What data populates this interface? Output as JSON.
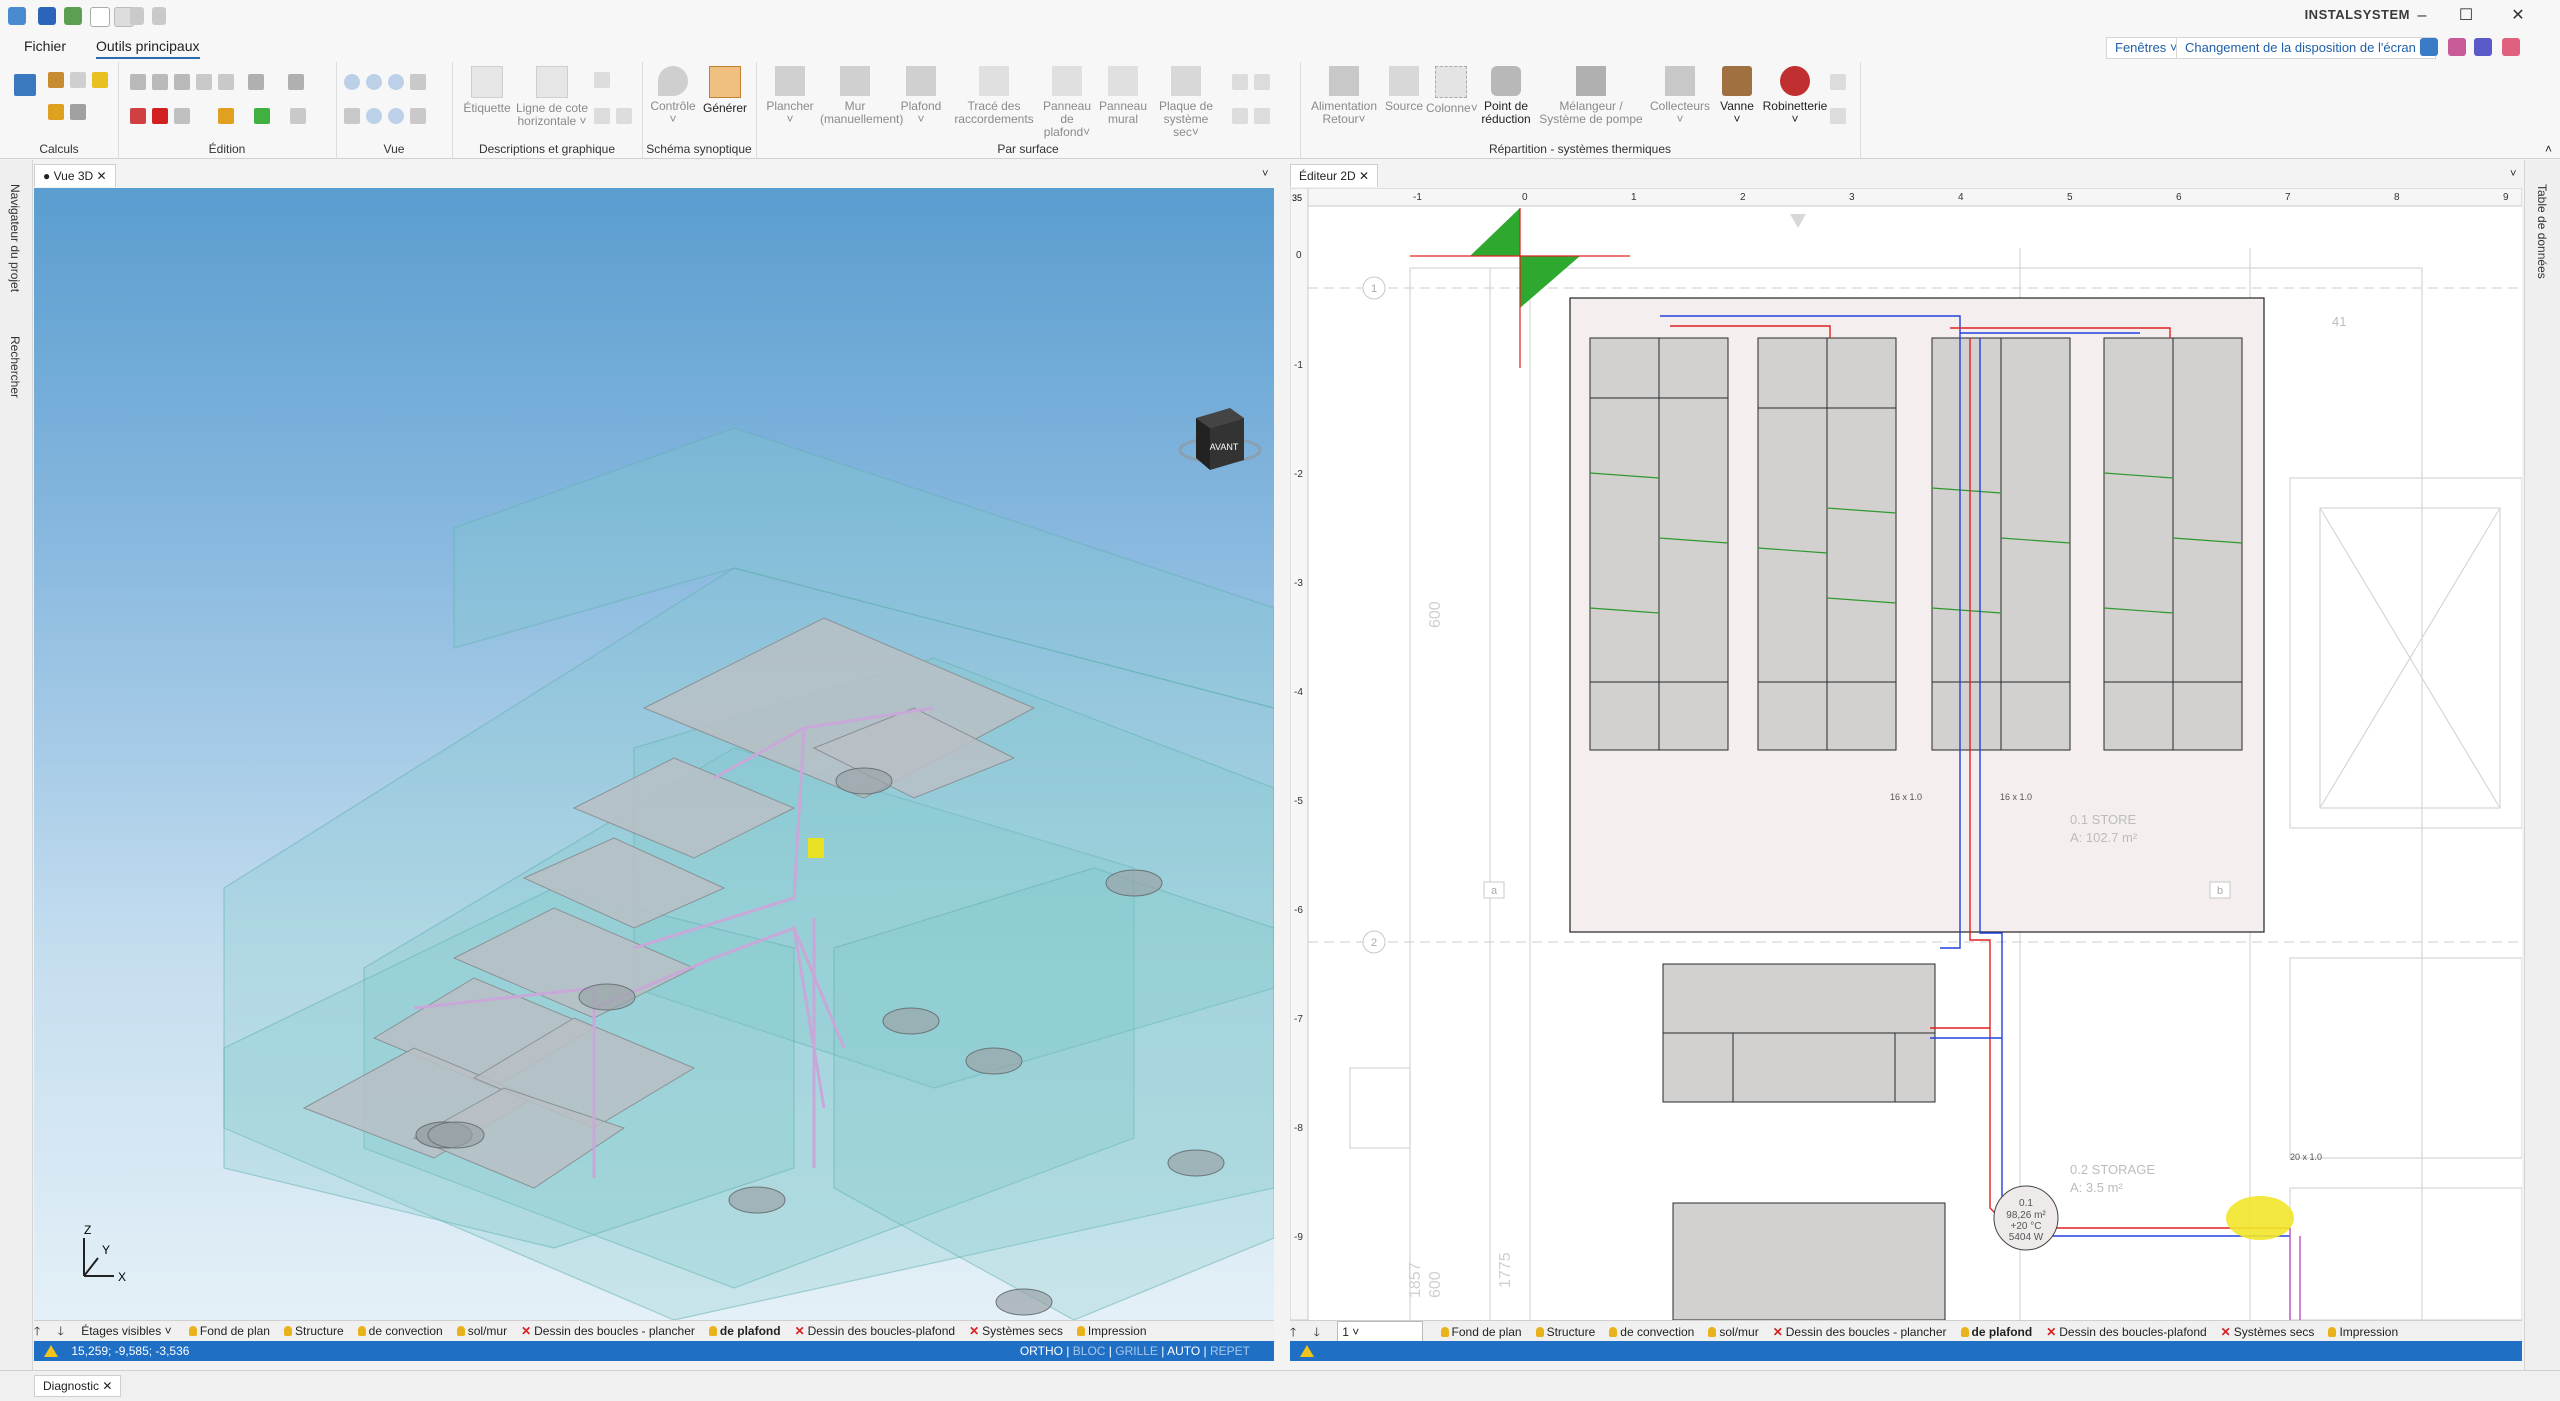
{
  "app": {
    "brand": "INSTALSYSTEM",
    "window_controls": [
      "minimize-icon",
      "maximize-icon",
      "close-icon"
    ]
  },
  "menu": {
    "tabs": [
      "Fichier",
      "Outils principaux"
    ],
    "right": {
      "windows": "Fenêtres",
      "layout": "Changement de la disposition de l'écran"
    }
  },
  "ribbon": {
    "groups": [
      "Calculs",
      "Édition",
      "Vue",
      "Descriptions et graphique",
      "Schéma synoptique",
      "Par surface",
      "Répartition - systèmes thermiques"
    ],
    "buttons": {
      "etiquette": "Étiquette",
      "ligne_cote": "Ligne de cote horizontale",
      "controle": "Contrôle",
      "generer": "Générer",
      "plancher": "Plancher",
      "mur": "Mur (manuellement)",
      "plafond": "Plafond",
      "trace": "Tracé des raccordements",
      "panneau_plafond": "Panneau de plafond",
      "panneau_mural": "Panneau mural",
      "plaque": "Plaque de système sec",
      "alimentation": "Alimentation Retour",
      "source": "Source",
      "colonne": "Colonne",
      "point": "Point de réduction",
      "melangeur": "Mélangeur / Système de pompe",
      "collecteurs": "Collecteurs",
      "vanne": "Vanne",
      "robinetterie": "Robinetterie"
    }
  },
  "side": {
    "left": [
      "Navigateur du projet",
      "Rechercher"
    ],
    "right": "Table de données"
  },
  "view3d": {
    "tab": "● Vue 3D",
    "cube_face": "AVANT",
    "axes": [
      "Z",
      "Y",
      "X"
    ]
  },
  "view2d": {
    "tab": "Éditeur 2D",
    "ruler_x": [
      "-1",
      "0",
      "1",
      "2",
      "3",
      "4",
      "5",
      "6",
      "7",
      "8",
      "9"
    ],
    "ruler_y": [
      "0",
      "-1",
      "-2",
      "-3",
      "-4",
      "-5",
      "-6",
      "-7",
      "-8",
      "-9"
    ],
    "ruler_corner": "35",
    "rooms": [
      {
        "name": "0.1  STORE",
        "area": "A: 102.7 m²"
      },
      {
        "name": "0.2  STORAGE",
        "area": "A: 3.5 m²"
      }
    ],
    "dims": [
      "600",
      "1857",
      "600",
      "1775"
    ],
    "grid_markers": [
      "1",
      "2",
      "a",
      "b"
    ],
    "grid_label": "41",
    "pipe_tags": [
      "16 x 1.0",
      "16 x 1.0",
      "20 x 1.0"
    ],
    "circle_tag": {
      "id": "0.1",
      "area": "98,26 m²",
      "temp": "+20 °C",
      "power": "5404 W"
    }
  },
  "layers": {
    "left_visible": "Étages visibles",
    "items": [
      {
        "label": "Fond de plan",
        "on": true,
        "bold": false
      },
      {
        "label": "Structure",
        "on": true,
        "bold": false
      },
      {
        "label": "de convection",
        "on": true,
        "bold": false
      },
      {
        "label": "sol/mur",
        "on": true,
        "bold": false
      },
      {
        "label": "Dessin des boucles - plancher",
        "on": false,
        "bold": false
      },
      {
        "label": "de plafond",
        "on": true,
        "bold": true
      },
      {
        "label": "Dessin des boucles-plafond",
        "on": false,
        "bold": false
      },
      {
        "label": "Systèmes secs",
        "on": false,
        "bold": false
      },
      {
        "label": "Impression",
        "on": true,
        "bold": false
      }
    ],
    "right_floor": "1"
  },
  "status": {
    "coords": "15,259; -9,585; -3,536",
    "modes": [
      "ORTHO",
      "BLOC",
      "GRILLE",
      "AUTO",
      "REPET"
    ]
  },
  "diagnostic": "Diagnostic",
  "colors": {
    "accent": "#1f6fc5",
    "supply": "#e02020",
    "return": "#2040e0",
    "grid_green": "#2e9a2e"
  }
}
